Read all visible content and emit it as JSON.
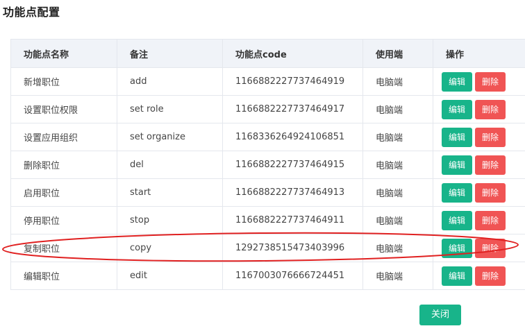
{
  "page": {
    "title": "功能点配置"
  },
  "table": {
    "headers": {
      "name": "功能点名称",
      "remark": "备注",
      "code": "功能点code",
      "client": "使用端",
      "ops": "操作"
    },
    "rows": [
      {
        "name": "新增职位",
        "remark": "add",
        "code": "1166882227737464919",
        "client": "电脑端"
      },
      {
        "name": "设置职位权限",
        "remark": "set role",
        "code": "1166882227737464917",
        "client": "电脑端"
      },
      {
        "name": "设置应用组织",
        "remark": "set organize",
        "code": "1168336264924106851",
        "client": "电脑端"
      },
      {
        "name": "删除职位",
        "remark": "del",
        "code": "1166882227737464915",
        "client": "电脑端"
      },
      {
        "name": "启用职位",
        "remark": "start",
        "code": "1166882227737464913",
        "client": "电脑端"
      },
      {
        "name": "停用职位",
        "remark": "stop",
        "code": "1166882227737464911",
        "client": "电脑端"
      },
      {
        "name": "复制职位",
        "remark": "copy",
        "code": "1292738515473403996",
        "client": "电脑端"
      },
      {
        "name": "编辑职位",
        "remark": "edit",
        "code": "1167003076666724451",
        "client": "电脑端"
      }
    ],
    "edit_label": "编辑",
    "delete_label": "删除"
  },
  "footer": {
    "close_label": "关闭"
  },
  "colors": {
    "edit": "#18b48a",
    "delete": "#f05454",
    "header_bg": "#f0f3f8",
    "annotation": "#e02020"
  }
}
